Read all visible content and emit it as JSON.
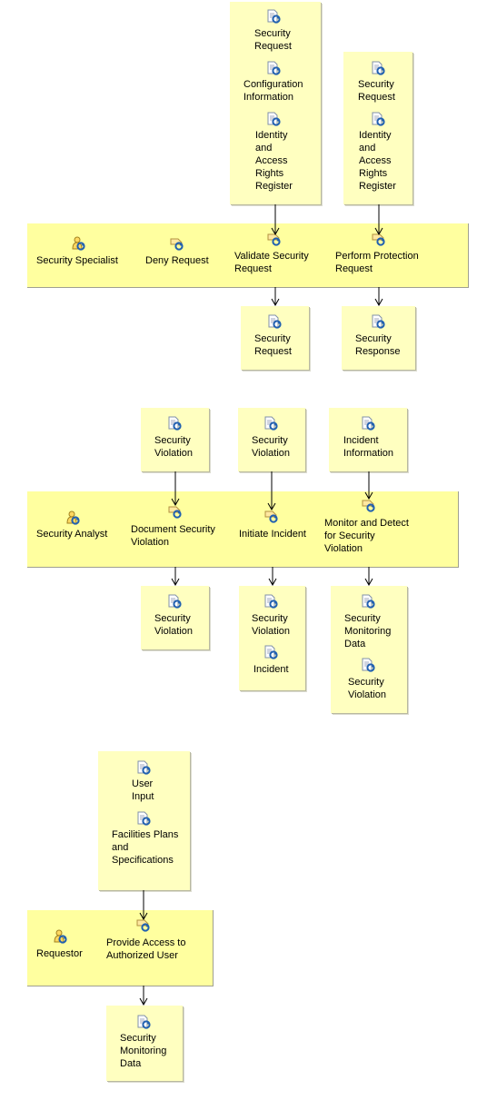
{
  "diagrams": [
    {
      "role": "Security Specialist",
      "activities": [
        "Deny Request",
        "Validate Security Request",
        "Perform Protection Request"
      ],
      "inputs": [
        [
          "Security Request",
          "Configuration Information",
          "Identity and Access Rights Register"
        ],
        [
          "Security Request",
          "Identity and Access Rights Register"
        ]
      ],
      "outputs": [
        [
          "Security Request"
        ],
        [
          "Security Response"
        ]
      ]
    },
    {
      "role": "Security Analyst",
      "activities": [
        "Document Security Violation",
        "Initiate Incident",
        "Monitor and Detect for Security Violation"
      ],
      "inputs": [
        [
          "Security Violation"
        ],
        [
          "Security Violation"
        ],
        [
          "Incident Information"
        ]
      ],
      "outputs": [
        [
          "Security Violation"
        ],
        [
          "Security Violation",
          "Incident"
        ],
        [
          "Security Monitoring Data",
          "Security Violation"
        ]
      ]
    },
    {
      "role": "Requestor",
      "activities": [
        "Provide Access to Authorized User"
      ],
      "inputs": [
        [
          "User Input",
          "Facilities Plans and Specifications"
        ]
      ],
      "outputs": [
        [
          "Security Monitoring Data"
        ]
      ]
    }
  ],
  "icons": {
    "artifact": "document-cycle-icon",
    "activity": "activity-cycle-icon",
    "role": "role-cycle-icon"
  },
  "colors": {
    "lane": "#ffff9f",
    "box": "#ffffc0",
    "arrows": "#4b8ec8"
  }
}
